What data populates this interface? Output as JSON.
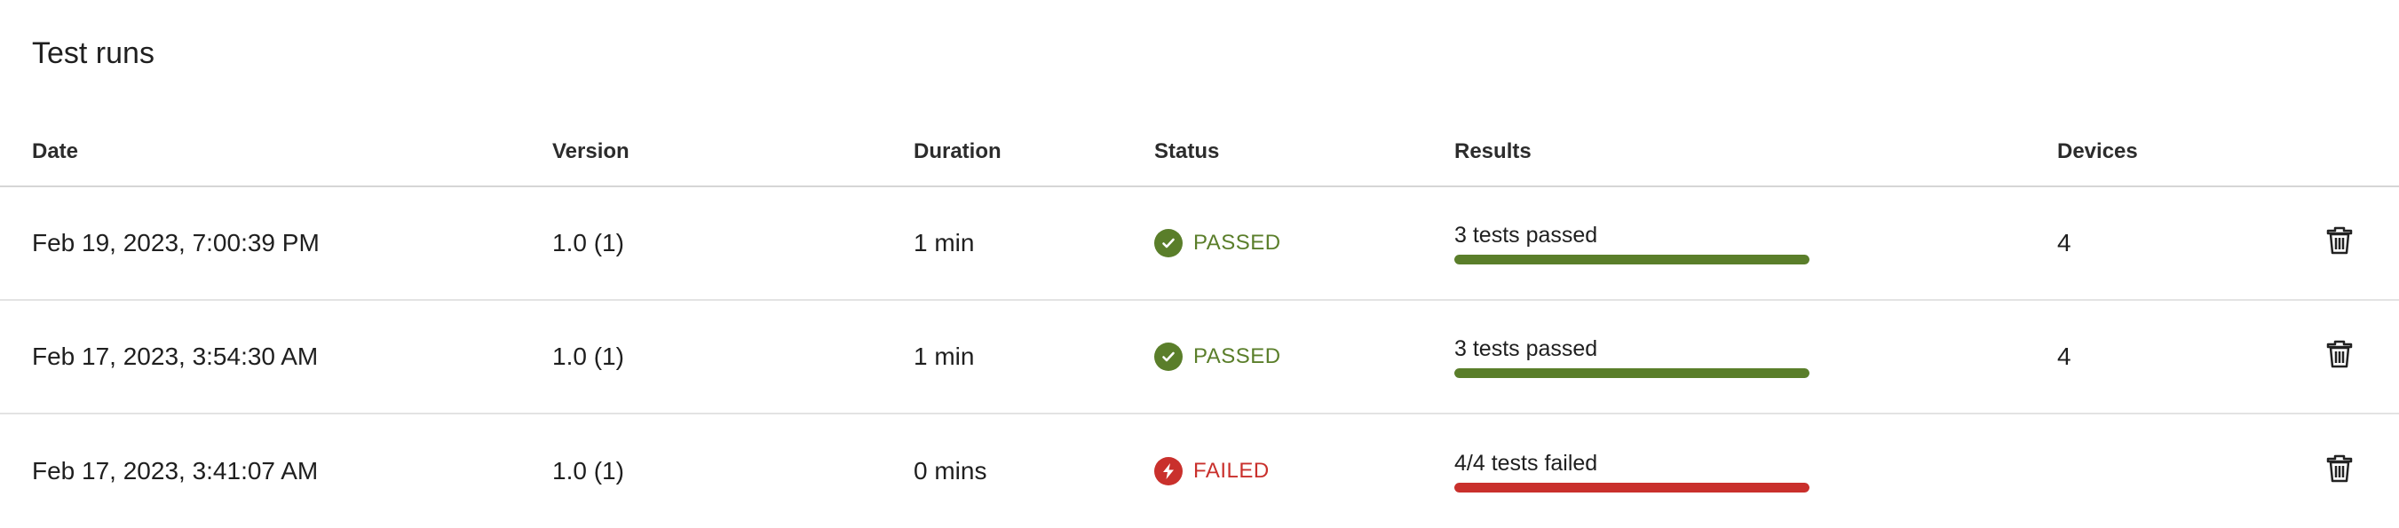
{
  "page": {
    "title": "Test runs"
  },
  "colors": {
    "passed": "#5a7e2a",
    "failed": "#c9302c",
    "header_text": "#2c2c2c",
    "divider": "#e3e3e3"
  },
  "table": {
    "columns": [
      "Date",
      "Version",
      "Duration",
      "Status",
      "Results",
      "Devices"
    ],
    "rows": [
      {
        "date": "Feb 19, 2023, 7:00:39 PM",
        "version": "1.0 (1)",
        "duration": "1 min",
        "status": "PASSED",
        "status_kind": "passed",
        "status_icon": "check-circle-icon",
        "results_text": "3 tests passed",
        "results_fraction": 1.0,
        "devices": "4",
        "action_icon": "trash-icon"
      },
      {
        "date": "Feb 17, 2023, 3:54:30 AM",
        "version": "1.0 (1)",
        "duration": "1 min",
        "status": "PASSED",
        "status_kind": "passed",
        "status_icon": "check-circle-icon",
        "results_text": "3 tests passed",
        "results_fraction": 1.0,
        "devices": "4",
        "action_icon": "trash-icon"
      },
      {
        "date": "Feb 17, 2023, 3:41:07 AM",
        "version": "1.0 (1)",
        "duration": "0 mins",
        "status": "FAILED",
        "status_kind": "failed",
        "status_icon": "lightning-circle-icon",
        "results_text": "4/4 tests failed",
        "results_fraction": 1.0,
        "devices": "",
        "action_icon": "trash-icon"
      }
    ]
  }
}
